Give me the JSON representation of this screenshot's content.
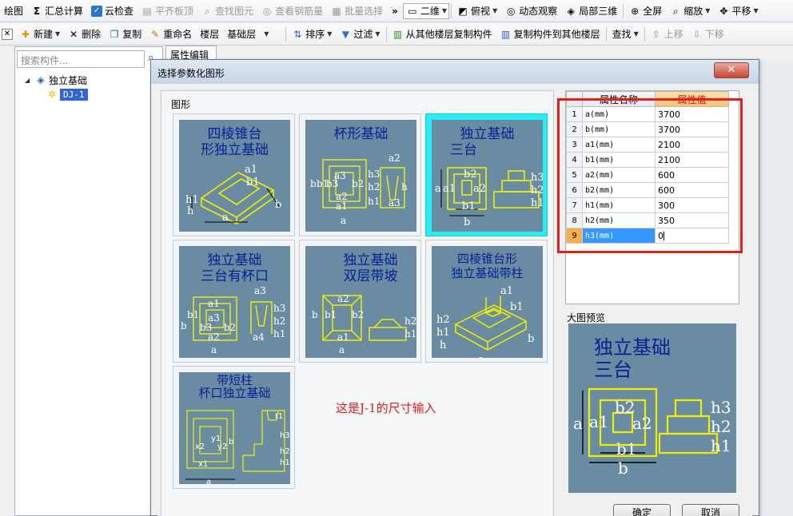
{
  "toolbar1": {
    "items": [
      {
        "label": "绘图",
        "icon": "draw-icon",
        "disabled": false
      },
      {
        "label": "汇总计算",
        "icon": "sigma-icon",
        "disabled": false
      },
      {
        "label": "云检查",
        "icon": "cloud-check-icon",
        "disabled": false
      },
      {
        "label": "平齐板顶",
        "icon": "align-top-icon",
        "disabled": true
      },
      {
        "label": "查找图元",
        "icon": "find-element-icon",
        "disabled": true
      },
      {
        "label": "查看钢筋量",
        "icon": "rebar-view-icon",
        "disabled": true
      },
      {
        "label": "批量选择",
        "icon": "batch-select-icon",
        "disabled": true
      }
    ],
    "view_combo": "二维",
    "view_items": [
      {
        "label": "俯视",
        "icon": "top-view-icon"
      },
      {
        "label": "动态观察",
        "icon": "orbit-icon"
      },
      {
        "label": "局部三维",
        "icon": "local-3d-icon"
      },
      {
        "label": "全屏",
        "icon": "fullscreen-icon"
      },
      {
        "label": "缩放",
        "icon": "zoom-icon"
      },
      {
        "label": "平移",
        "icon": "pan-icon"
      }
    ]
  },
  "toolbar2": {
    "new_label": "新建",
    "delete_label": "删除",
    "copy_label": "复制",
    "rename_label": "重命名",
    "floor_label": "楼层",
    "floor_value": "基础层",
    "sort_label": "排序",
    "filter_label": "过滤",
    "copy_from_label": "从其他楼层复制构件",
    "copy_to_label": "复制构件到其他楼层",
    "find_label": "查找",
    "up_label": "上移",
    "down_label": "下移"
  },
  "left_panel": {
    "search_placeholder": "搜索构件...",
    "tree_root": "独立基础",
    "tree_child": "DJ-1"
  },
  "editor_tab": "属性编辑",
  "dialog": {
    "title": "选择参数化图形",
    "close_label": "✕",
    "group_label": "图形",
    "note": "这是J-1的尺寸输入",
    "ok_label": "确定",
    "cancel_label": "取消",
    "preview_label": "大图预览",
    "preview_title": [
      "独立基础",
      "三台"
    ],
    "shapes": [
      {
        "title": [
          "四棱锥台",
          "形独立基础"
        ],
        "labels": [
          "a1",
          "b1",
          "h1",
          "h",
          "a",
          "b"
        ]
      },
      {
        "title": [
          "杯形基础"
        ],
        "labels": [
          "a2",
          "a3",
          "a2",
          "b",
          "b1",
          "b3",
          "b2",
          "a1",
          "a",
          "h3",
          "h2",
          "h1",
          "a3",
          "h"
        ]
      },
      {
        "title": [
          "独立基础",
          "三台"
        ],
        "labels": [
          "b2",
          "a1",
          "a2",
          "a",
          "b1",
          "b",
          "h3",
          "h2",
          "h1"
        ]
      },
      {
        "title": [
          "独立基础",
          "三台有杯口"
        ],
        "labels": [
          "a3",
          "a1",
          "b1",
          "a3",
          "b",
          "b3",
          "b2",
          "a2",
          "a",
          "a4",
          "h3",
          "h2",
          "h1"
        ]
      },
      {
        "title": [
          "独立基础",
          "双层带坡"
        ],
        "labels": [
          "a2",
          "b1",
          "b2",
          "b",
          "a1",
          "a",
          "h2",
          "h1"
        ]
      },
      {
        "title": [
          "四棱锥台形",
          "独立基础带柱"
        ],
        "labels": [
          "a1",
          "b1",
          "h2",
          "h1",
          "h",
          "a",
          "b"
        ]
      },
      {
        "title": [
          "带短柱",
          "杯口独立基础"
        ],
        "labels": [
          "a",
          "b",
          "x1",
          "x2",
          "y1",
          "y2",
          "h1",
          "h2",
          "h3",
          "t1"
        ]
      }
    ],
    "properties": {
      "header_name": "属性名称",
      "header_value": "属性值",
      "rows": [
        {
          "index": "1",
          "name": "a(mm)",
          "value": "3700"
        },
        {
          "index": "2",
          "name": "b(mm)",
          "value": "3700"
        },
        {
          "index": "3",
          "name": "a1(mm)",
          "value": "2100"
        },
        {
          "index": "4",
          "name": "b1(mm)",
          "value": "2100"
        },
        {
          "index": "5",
          "name": "a2(mm)",
          "value": "600"
        },
        {
          "index": "6",
          "name": "b2(mm)",
          "value": "600"
        },
        {
          "index": "7",
          "name": "h1(mm)",
          "value": "300"
        },
        {
          "index": "8",
          "name": "h2(mm)",
          "value": "350"
        },
        {
          "index": "9",
          "name": "h3(mm)",
          "value": "0"
        }
      ],
      "active_row": 8
    },
    "colors": {
      "thumb_bg": "#6a8ca3",
      "thumb_line": "#f0f000",
      "thumb_title": "#0a1e96",
      "selection": "#29ecf5",
      "highlight": "#e81e1e"
    }
  }
}
